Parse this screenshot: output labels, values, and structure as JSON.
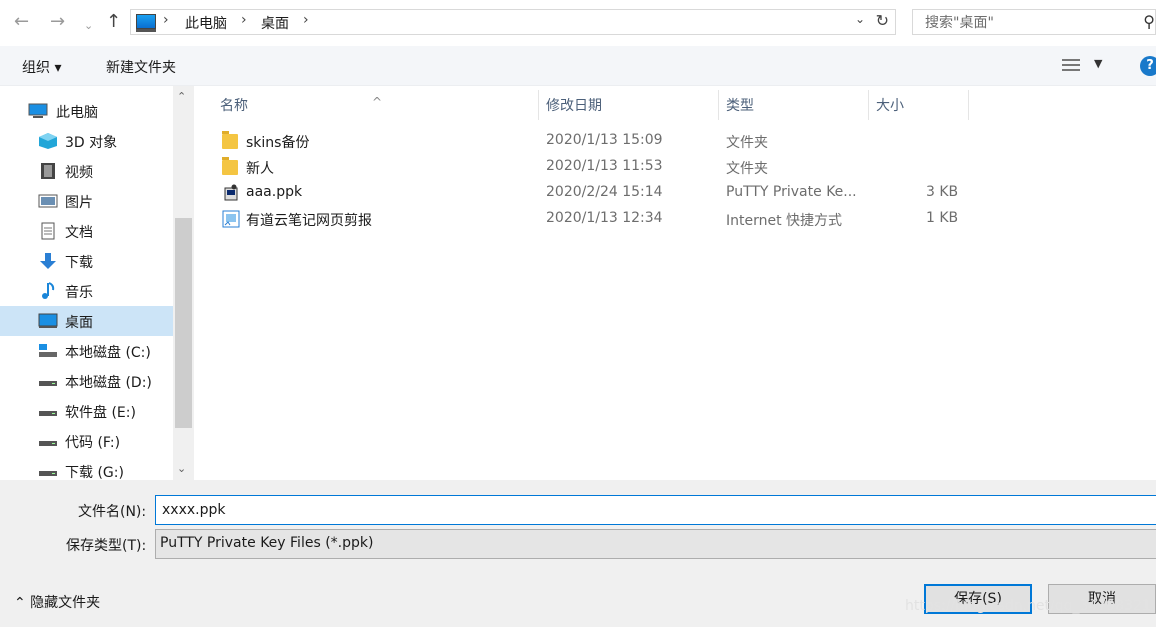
{
  "address": {
    "crumbs": [
      "此电脑",
      "桌面"
    ],
    "search_placeholder": "搜索\"桌面\""
  },
  "toolbar": {
    "organize": "组织 ▾",
    "new_folder": "新建文件夹",
    "help": "?"
  },
  "nav": {
    "items": [
      {
        "label": "此电脑"
      },
      {
        "label": "3D 对象"
      },
      {
        "label": "视频"
      },
      {
        "label": "图片"
      },
      {
        "label": "文档"
      },
      {
        "label": "下载"
      },
      {
        "label": "音乐"
      },
      {
        "label": "桌面"
      },
      {
        "label": "本地磁盘 (C:)"
      },
      {
        "label": "本地磁盘 (D:)"
      },
      {
        "label": "软件盘 (E:)"
      },
      {
        "label": "代码 (F:)"
      },
      {
        "label": "下载 (G:)"
      }
    ]
  },
  "columns": {
    "name": "名称",
    "date": "修改日期",
    "type": "类型",
    "size": "大小"
  },
  "files": [
    {
      "name": "skins备份",
      "date": "2020/1/13 15:09",
      "type": "文件夹",
      "size": ""
    },
    {
      "name": "新人",
      "date": "2020/1/13 11:53",
      "type": "文件夹",
      "size": ""
    },
    {
      "name": "aaa.ppk",
      "date": "2020/2/24 15:14",
      "type": "PuTTY Private Ke...",
      "size": "3 KB"
    },
    {
      "name": "有道云笔记网页剪报",
      "date": "2020/1/13 12:34",
      "type": "Internet 快捷方式",
      "size": "1 KB"
    }
  ],
  "form": {
    "filename_label": "文件名(N):",
    "filename_value": "xxxx.ppk",
    "filetype_label": "保存类型(T):",
    "filetype_value": "PuTTY Private Key Files (*.ppk)",
    "hide_folders": "⌃ 隐藏文件夹",
    "save": "保存(S)",
    "cancel": "取消"
  },
  "watermark": "https://blog.csdn.net/qq_34798321",
  "colors": {
    "accent": "#0078d7",
    "selected_bg": "#cce4f7",
    "folder": "#f4c542"
  }
}
